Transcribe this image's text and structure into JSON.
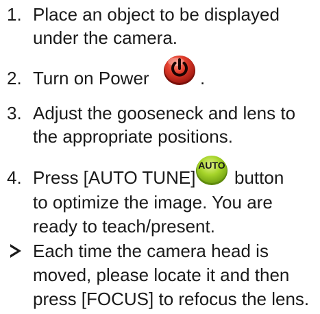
{
  "steps": [
    {
      "number": "1.",
      "lines": [
        "Place an object to be displayed",
        "under the camera."
      ]
    },
    {
      "number": "2.",
      "text": "Turn on Power",
      "suffix": ".",
      "icon": "power-button-icon",
      "icon_color": "#d8342a"
    },
    {
      "number": "3.",
      "lines": [
        "Adjust the gooseneck and lens to",
        "the appropriate positions."
      ]
    },
    {
      "number": "4.",
      "text": "Press [AUTO TUNE]",
      "icon": "auto-button-icon",
      "icon_label": "AUTO",
      "icon_color": "#8ec21a",
      "after_icon": "button",
      "lines": [
        "to optimize the image. You are",
        "ready to teach/present."
      ]
    }
  ],
  "note": {
    "bullet": "arrow-bullet-icon",
    "lines": [
      "Each time the camera head is",
      "moved, please locate it and then",
      "press [FOCUS] to refocus the lens."
    ]
  }
}
